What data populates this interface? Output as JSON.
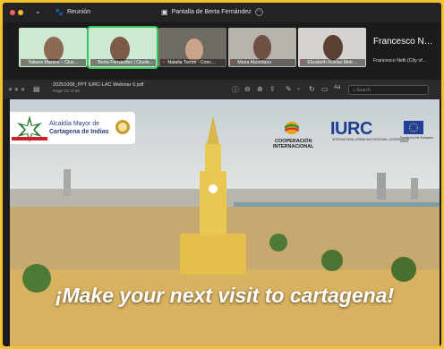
{
  "titlebar": {
    "meeting_label": "Reunión",
    "screen_tab_label": "Pantalla de Berta Fernández",
    "colors": {
      "close": "#ff5f57",
      "minimize": "#febc2e",
      "maximize": "#28c840"
    }
  },
  "participants": [
    {
      "name": "Tatiane Martins – Clus…",
      "muted": true
    },
    {
      "name": "Berta Fernández | Cluste…",
      "muted": true,
      "active": true
    },
    {
      "name": "Natalia Torres - Conc…",
      "muted": true
    },
    {
      "name": "Maria Abondano",
      "muted": true
    },
    {
      "name": "Elizabeth Ruelas Metr…",
      "muted": true
    }
  ],
  "featured_participant": {
    "display_name": "Francesco N…",
    "full_label": "Francesco Nelli (City of…"
  },
  "pdf_viewer": {
    "file_name": "20251008_PPT IURC-LAC Webinar 6.pdf",
    "page_indicator": "Page 22 of 86",
    "search_placeholder": "Search",
    "zoom_label": "Aa"
  },
  "slide": {
    "alcaldia_line1": "Alcaldía Mayor de",
    "alcaldia_line2": "Cartagena de Indias",
    "cooperacion_line1": "COOPERACIÓN",
    "cooperacion_line2": "INTERNACIONAL",
    "iurc_logo": "IURC",
    "iurc_subtitle": "INTERNATIONAL URBAN AND REGIONAL COOPERATION",
    "eu_subtitle": "Funded by the European Union",
    "headline": "¡Make your next visit to cartagena!",
    "colors": {
      "accent_blue": "#1e3f8f",
      "headline": "#ffffff"
    }
  }
}
